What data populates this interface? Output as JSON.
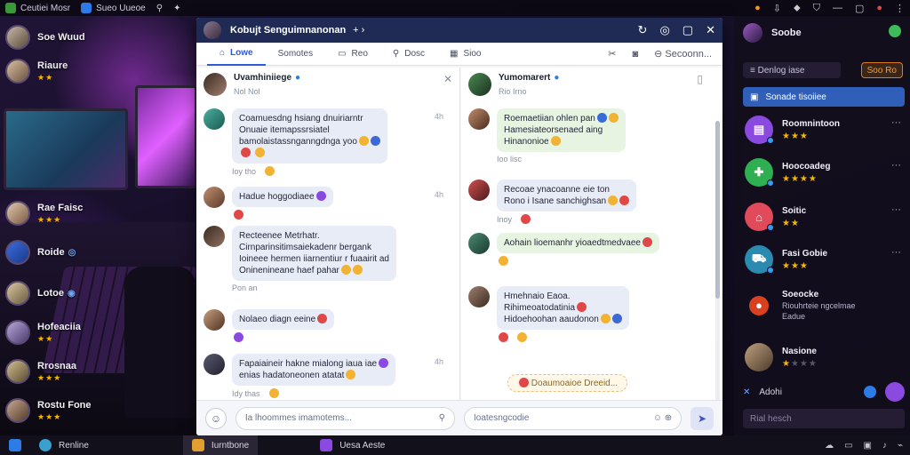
{
  "topbar": {
    "apps": [
      {
        "label": "Ceutiei Mosr"
      },
      {
        "label": "Sueo Uueoe"
      }
    ]
  },
  "left_list": [
    {
      "name": "Soe Wuud",
      "stars": "",
      "badge": ""
    },
    {
      "name": "Riaure",
      "stars": "★★",
      "badge": ""
    },
    {
      "name": "Rae Faisc",
      "stars": "★★★",
      "badge": ""
    },
    {
      "name": "Roide",
      "stars": "",
      "badge": "◎"
    },
    {
      "name": "Lotoe",
      "stars": "",
      "badge": "◉"
    },
    {
      "name": "Hofeaciia",
      "stars": "★★",
      "badge": ""
    },
    {
      "name": "Rrosnaa",
      "stars": "★★★",
      "badge": ""
    },
    {
      "name": "Rostu Fone",
      "stars": "★★★",
      "badge": ""
    }
  ],
  "window": {
    "title": "Kobujt Senguimnanonan",
    "title_extra": "+ ›",
    "tabs": [
      {
        "label": "Lowe",
        "active": true
      },
      {
        "label": "Somotes",
        "active": false
      },
      {
        "label": "Reo",
        "active": false
      },
      {
        "label": "Dosc",
        "active": false
      },
      {
        "label": "Sioo",
        "active": false
      }
    ],
    "tools_label": "Secoonn...",
    "left_pane": {
      "header_name": "Uvamhiniiege",
      "header_sub": "Nol Nol",
      "messages": [
        {
          "lines": [
            "Coamuesdng hsiang dnuiriarntr",
            "Onuaie itemapssrsiatel",
            "bamolaistassnganngdnga yoo"
          ],
          "meta": "Ioy tho",
          "time": "4h"
        },
        {
          "lines": [
            "Hadue hoggodiaee"
          ],
          "meta": "Ioy  Iso",
          "time": "4h"
        },
        {
          "lines": [
            "Recteenee Metrhatr.",
            "Cirnparinsitimsaiekadenr bergank",
            "Ioineee hermen iiarnentiur r fuaairit ad",
            "Oninenineane haef pahar"
          ],
          "meta": "Pon an",
          "time": ""
        },
        {
          "lines": [
            "Nolaeo diagn eeine"
          ],
          "meta": "",
          "time": ""
        },
        {
          "lines": [
            "Fapaiaineir hakne mialong iaua iae",
            "enias hadatoneonen atatat"
          ],
          "meta": "Idy thas",
          "time": "4h"
        }
      ]
    },
    "right_pane": {
      "header_name": "Yumomarert",
      "header_sub": "Rio Irno",
      "messages": [
        {
          "lines": [
            "Roemaetiian ohlen pan",
            "Hamesiateorsenaed aing",
            "Hinanonioe"
          ],
          "meta": "Ioo lisc",
          "time": ""
        },
        {
          "lines": [
            "Recoae ynacoanne eie ton",
            "Rono i Isane sanchighsan"
          ],
          "meta": "Inoy",
          "time": ""
        },
        {
          "lines": [
            "Aohain lioemanhr yioaedtmedvaee"
          ],
          "meta": "",
          "time": ""
        },
        {
          "lines": [
            "Hmehnaio Eaoa.",
            "Rihimeoatodatinia",
            "Hidoehoohan aaudonon"
          ],
          "meta": "",
          "time": ""
        }
      ],
      "system_chip": "Doaumoaioe Dreeid..."
    },
    "composer": {
      "left_placeholder": "Ia lhoommes imamotems...",
      "right_placeholder": "Ioatesngcodie"
    }
  },
  "right_panel": {
    "title": "Soobe",
    "sort_label": "Denlog iase",
    "badge_label": "Soo Ro",
    "search_label": "Sonade tisoiiee",
    "items": [
      {
        "name": "Roomnintoon",
        "sub": "",
        "stars": 3,
        "color": "#8a4ae0",
        "glyph": "▤"
      },
      {
        "name": "Hoocoadeg",
        "sub": "",
        "stars": 4,
        "color": "#2fae52",
        "glyph": "✚"
      },
      {
        "name": "Soitic",
        "sub": "",
        "stars": 2,
        "color": "#e04a5a",
        "glyph": "⌂"
      },
      {
        "name": "Fasi Gobie",
        "sub": "",
        "stars": 3,
        "color": "#2a8ab0",
        "glyph": "⛟"
      },
      {
        "name": "Soeocke",
        "sub": "Riouhrteie ngcelmae",
        "stars": 0,
        "color": "#d84020",
        "glyph": "●"
      },
      {
        "name": "Nasione",
        "sub": "",
        "stars": 4,
        "color": "#6a5a40",
        "glyph": ""
      }
    ],
    "item_extra_line": "Eadue",
    "compose_label": "Adohi",
    "find_placeholder": "Rial hesch"
  },
  "taskbar": {
    "items": [
      {
        "label": "Renline"
      },
      {
        "label": "Iurntbone"
      },
      {
        "label": "Uesa Aeste"
      }
    ]
  }
}
